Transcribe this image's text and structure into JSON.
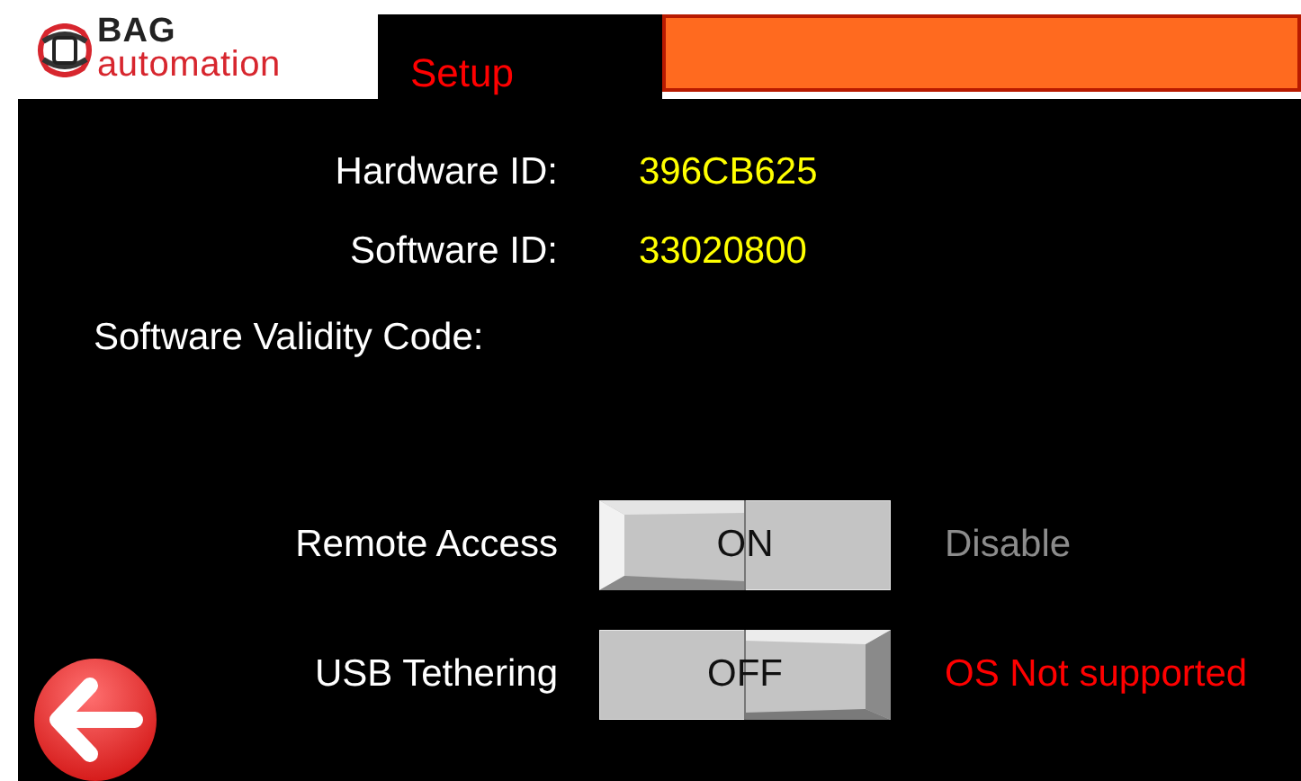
{
  "logo": {
    "brand": "BAG",
    "subtitle": "automation"
  },
  "tab": {
    "label": "Setup",
    "selected": true
  },
  "fields": [
    {
      "kind": "value",
      "label": "Hardware ID:",
      "value": "396CB625"
    },
    {
      "kind": "value",
      "label": "Software ID:",
      "value": "33020800"
    },
    {
      "kind": "heading",
      "label": "Software Validity Code:"
    }
  ],
  "toggles": [
    {
      "label": "Remote Access",
      "value": "ON",
      "on": true,
      "status": "Disable",
      "color": "#8c8c8c"
    },
    {
      "label": "USB Tethering",
      "value": "OFF",
      "on": false,
      "status": "OS Not supported",
      "color": "#ff0000"
    }
  ]
}
